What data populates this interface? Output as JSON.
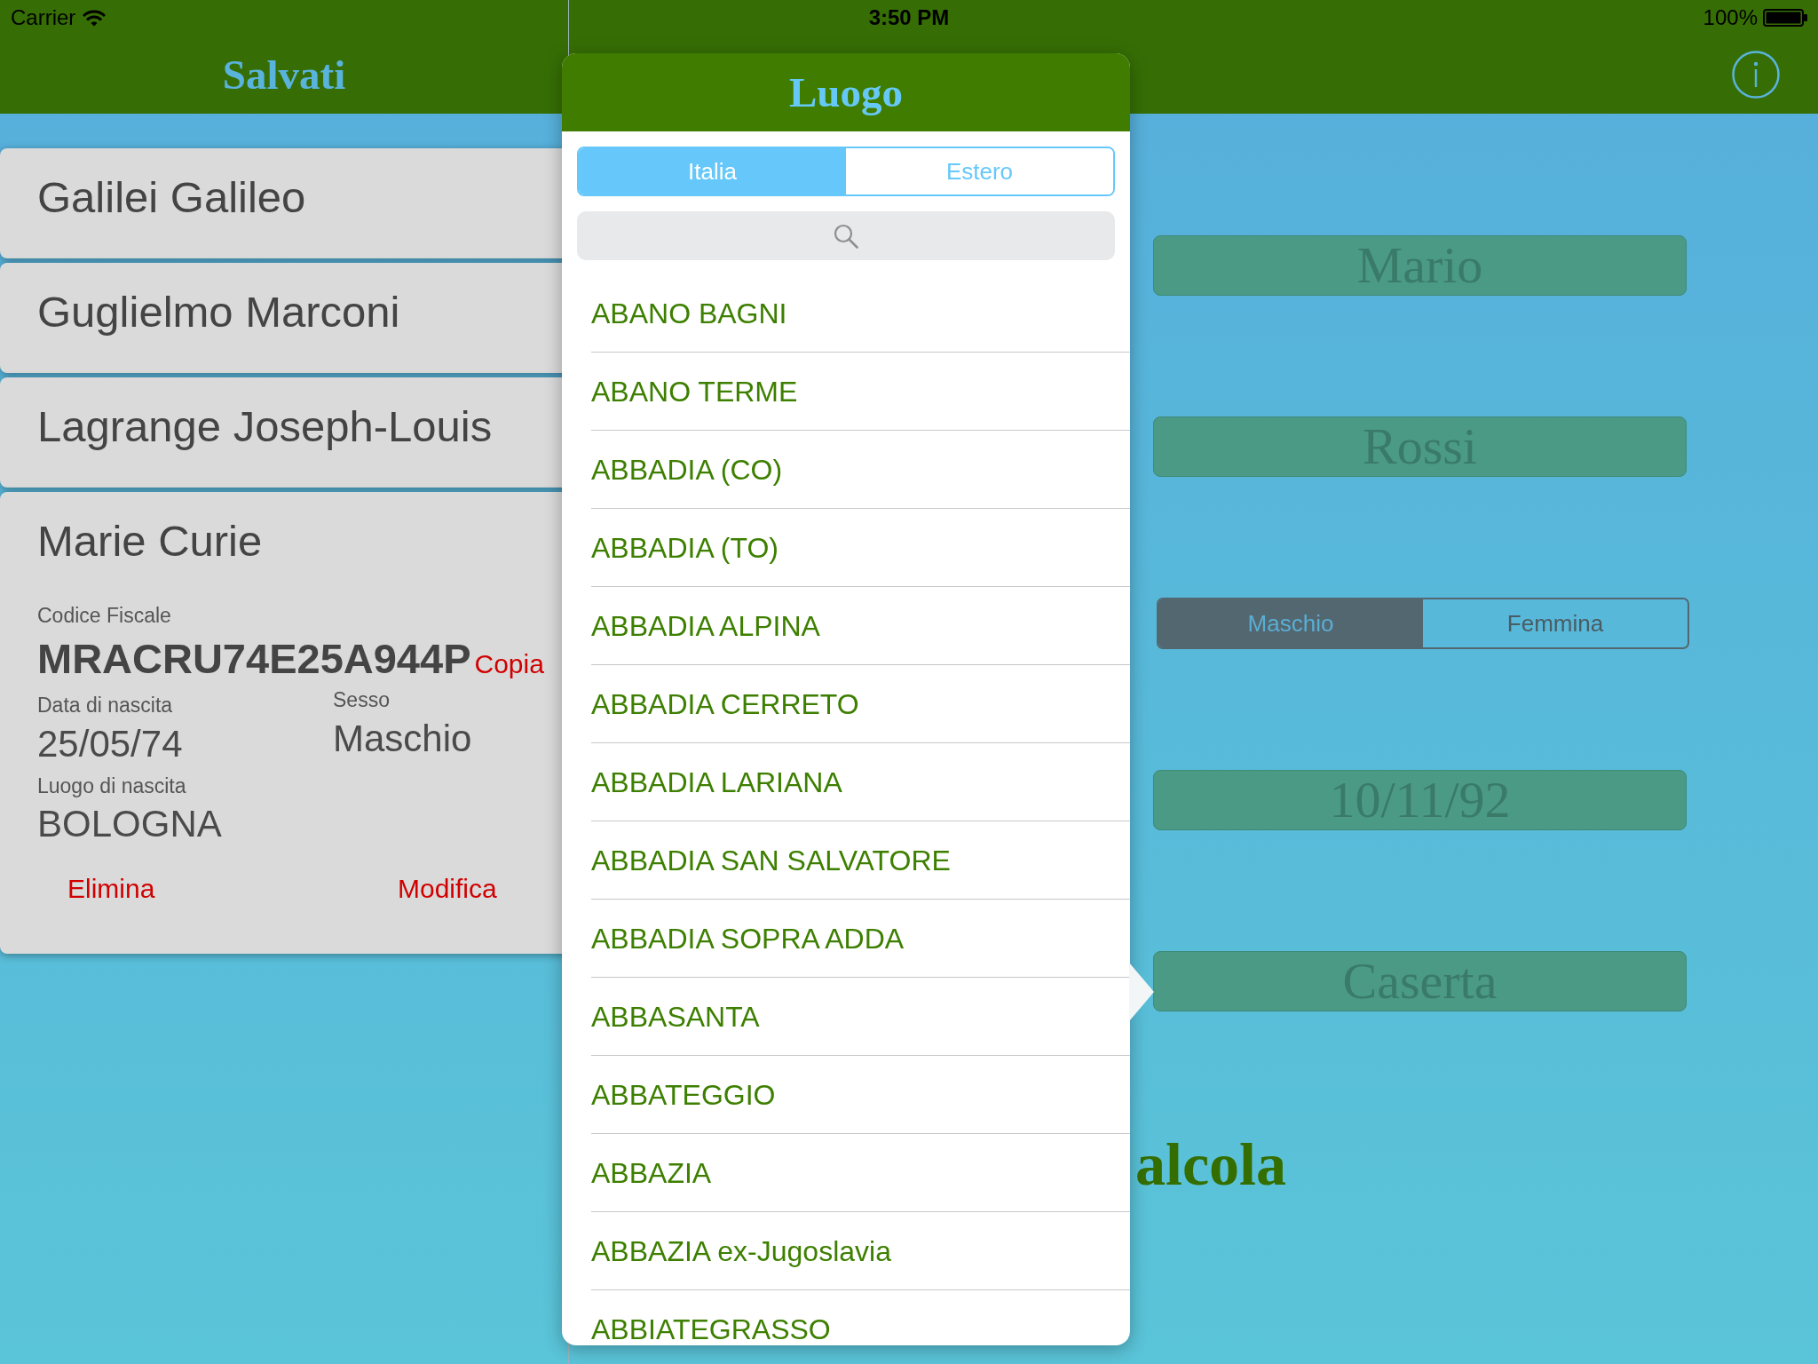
{
  "status_bar": {
    "carrier": "Carrier",
    "time": "3:50 PM",
    "battery": "100%"
  },
  "saved_panel": {
    "title": "Salvati",
    "entries": [
      {
        "name": "Galilei Galileo",
        "expanded": false
      },
      {
        "name": "Guglielmo Marconi",
        "expanded": false
      },
      {
        "name": "Lagrange Joseph-Louis",
        "expanded": false
      },
      {
        "name": "Marie Curie",
        "expanded": true,
        "details": {
          "fiscal_code_label": "Codice Fiscale",
          "fiscal_code": "MRACRU74E25A944P",
          "copy_button": "Copia",
          "birth_date_label": "Data di nascita",
          "birth_date": "25/05/74",
          "sex_label": "Sesso",
          "sex": "Maschio",
          "birth_place_label": "Luogo di nascita",
          "birth_place": "BOLOGNA",
          "delete_button": "Elimina",
          "edit_button": "Modifica"
        }
      }
    ]
  },
  "form": {
    "fields": [
      {
        "kind": "text",
        "value": "Mario"
      },
      {
        "kind": "text",
        "value": "Rossi"
      },
      {
        "kind": "segmented",
        "options": [
          {
            "label": "Maschio",
            "selected": true
          },
          {
            "label": "Femmina",
            "selected": false
          }
        ]
      },
      {
        "kind": "text",
        "value": "10/11/92"
      },
      {
        "kind": "text",
        "value": "Caserta"
      }
    ],
    "calculate_button": "alcola"
  },
  "place_popover": {
    "title": "Luogo",
    "tabs": [
      {
        "label": "Italia",
        "selected": true
      },
      {
        "label": "Estero",
        "selected": false
      }
    ],
    "places": [
      "ABANO BAGNI",
      "ABANO TERME",
      "ABBADIA (CO)",
      "ABBADIA (TO)",
      "ABBADIA ALPINA",
      "ABBADIA CERRETO",
      "ABBADIA LARIANA",
      "ABBADIA SAN SALVATORE",
      "ABBADIA SOPRA ADDA",
      "ABBASANTA",
      "ABBATEGGIO",
      "ABBAZIA",
      "ABBAZIA ex-Jugoslavia",
      "ABBIATEGRASSO"
    ]
  }
}
